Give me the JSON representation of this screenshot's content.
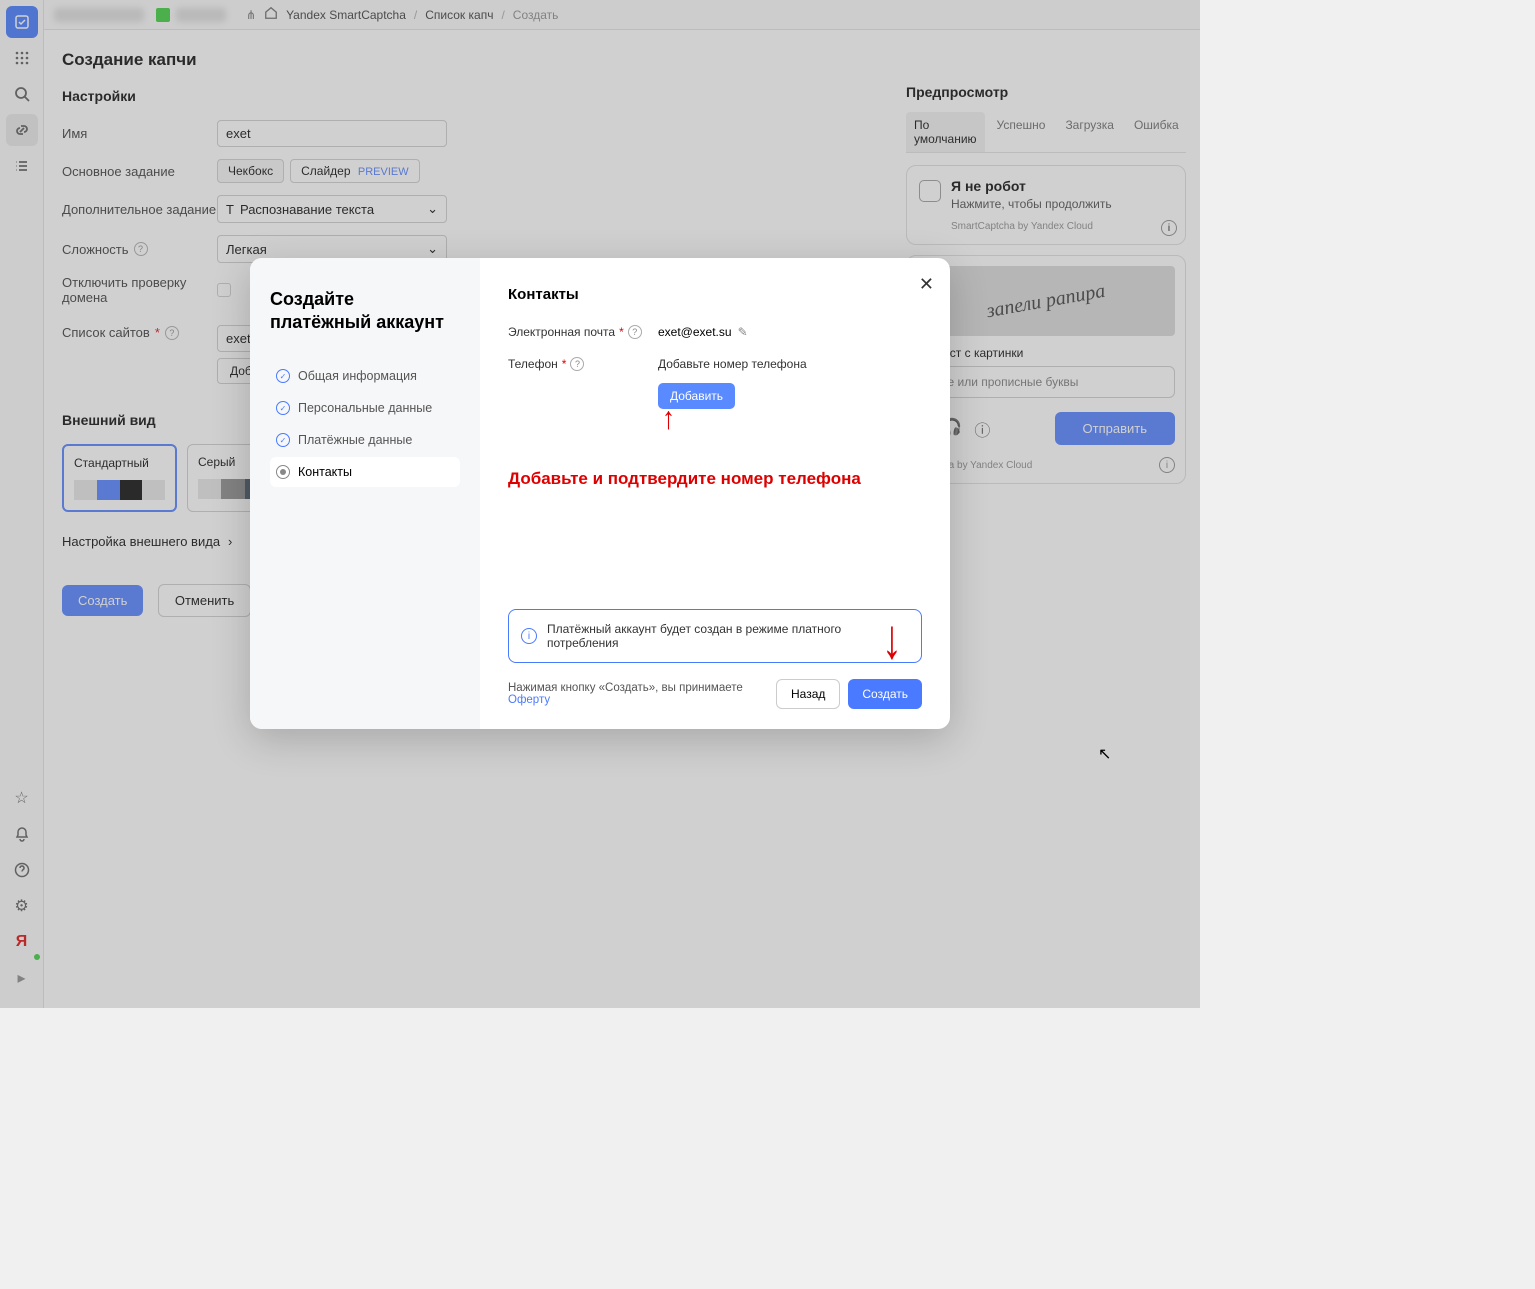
{
  "breadcrumb": {
    "service": "Yandex SmartCaptcha",
    "list": "Список капч",
    "current": "Создать"
  },
  "sidebar_icons": [
    "check",
    "grid",
    "search",
    "link",
    "list"
  ],
  "sidebar_bottom": [
    "star",
    "bell",
    "help",
    "gear",
    "yandex",
    "play"
  ],
  "page": {
    "title": "Создание капчи",
    "settings_title": "Настройки"
  },
  "form": {
    "name_label": "Имя",
    "name_value": "exet",
    "main_task_label": "Основное задание",
    "checkbox_btn": "Чекбокс",
    "slider_btn": "Слайдер",
    "preview_badge": "PREVIEW",
    "extra_task_label": "Дополнительное задание",
    "extra_task_value": "Распознавание текста",
    "difficulty_label": "Сложность",
    "difficulty_value": "Легкая",
    "domain_check_label": "Отключить проверку домена",
    "sites_label": "Список сайтов",
    "sites_value": "exet.su",
    "add_btn": "Добавить",
    "appearance_title": "Внешний вид",
    "theme_standard": "Стандартный",
    "theme_gray": "Серый",
    "appearance_settings": "Настройка внешнего вида",
    "create_btn": "Создать",
    "cancel_btn": "Отменить"
  },
  "preview": {
    "title": "Предпросмотр",
    "tabs": [
      "По умолчанию",
      "Успешно",
      "Загрузка",
      "Ошибка"
    ],
    "robot_title": "Я не робот",
    "robot_sub": "Нажмите, чтобы продолжить",
    "brand": "SmartCaptcha by Yandex Cloud",
    "challenge_text": "запели рапира",
    "enter_text": "те текст с картинки",
    "placeholder": "чные или прописные буквы",
    "submit": "Отправить",
    "footer": "Captcha by Yandex Cloud"
  },
  "modal": {
    "title": "Создайте платёжный аккаунт",
    "steps": [
      "Общая информация",
      "Персональные данные",
      "Платёжные данные",
      "Контакты"
    ],
    "body_title": "Контакты",
    "email_label": "Электронная почта",
    "email_value": "exet@exet.su",
    "phone_label": "Телефон",
    "phone_hint": "Добавьте номер телефона",
    "add_btn": "Добавить",
    "annotation": "Добавьте и подтвердите номер телефона",
    "info": "Платёжный аккаунт будет создан в режиме платного потребления",
    "terms_prefix": "Нажимая кнопку «Создать», вы принимаете ",
    "terms_link": "Оферту",
    "back": "Назад",
    "create": "Создать"
  }
}
